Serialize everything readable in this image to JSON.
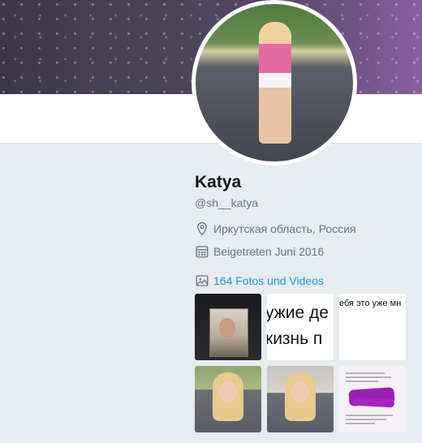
{
  "profile": {
    "name": "Katya",
    "handle": "@sh__katya",
    "location": "Иркутская область, Россия",
    "joined": "Beigetreten Juni 2016",
    "media_link": "164 Fotos und Videos"
  },
  "icons": {
    "location": "location-pin-icon",
    "joined": "calendar-icon",
    "media": "image-icon"
  },
  "colors": {
    "link": "#1b95e0",
    "muted": "#657786",
    "background": "#e6ecf0"
  },
  "media_grid": {
    "thumb2_lines": [
      "ужие де",
      "кизнь п"
    ],
    "thumb3_line": "ебя это уже мн"
  }
}
